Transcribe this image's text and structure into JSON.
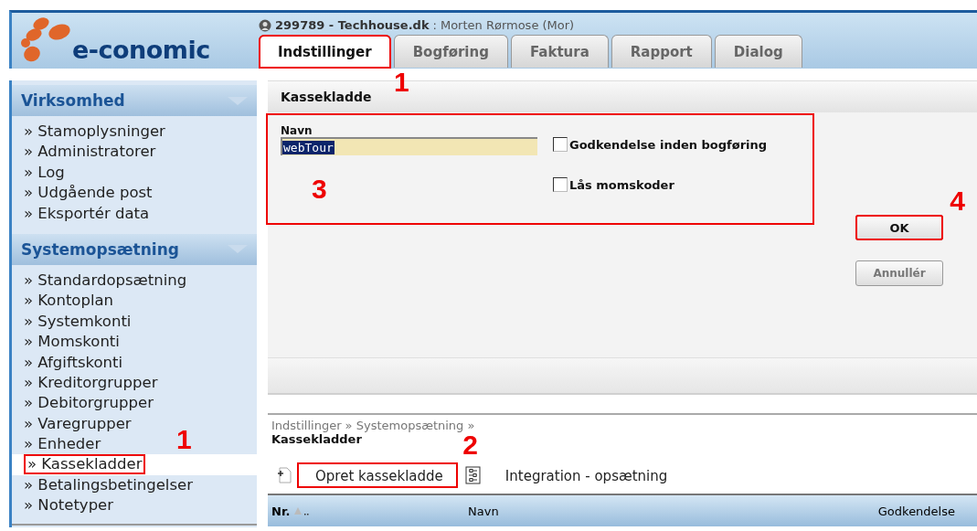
{
  "header": {
    "logo_text": "e-conomic",
    "account": "299789 - Techhouse.dk",
    "separator": ":",
    "user": "Morten Rørmose (Mor)"
  },
  "tabs": [
    {
      "label": "Indstillinger",
      "selected": true,
      "callout": "1"
    },
    {
      "label": "Bogføring",
      "selected": false
    },
    {
      "label": "Faktura",
      "selected": false
    },
    {
      "label": "Rapport",
      "selected": false
    },
    {
      "label": "Dialog",
      "selected": false
    }
  ],
  "sidebar": {
    "sections": [
      {
        "title": "Virksomhed",
        "items": [
          {
            "label": "» Stamoplysninger",
            "selected": false
          },
          {
            "label": "» Administratorer",
            "selected": false
          },
          {
            "label": "» Log",
            "selected": false
          },
          {
            "label": "» Udgående post",
            "selected": false
          },
          {
            "label": "» Eksportér data",
            "selected": false
          }
        ]
      },
      {
        "title": "Systemopsætning",
        "items": [
          {
            "label": "» Standardopsætning",
            "selected": false
          },
          {
            "label": "» Kontoplan",
            "selected": false
          },
          {
            "label": "» Systemkonti",
            "selected": false
          },
          {
            "label": "» Momskonti",
            "selected": false
          },
          {
            "label": "» Afgiftskonti",
            "selected": false
          },
          {
            "label": "» Kreditorgrupper",
            "selected": false
          },
          {
            "label": "» Debitorgrupper",
            "selected": false
          },
          {
            "label": "» Varegrupper",
            "selected": false
          },
          {
            "label": "» Enheder",
            "selected": false
          },
          {
            "label": "» Kassekladder",
            "selected": true,
            "callout": "1"
          },
          {
            "label": "» Betalingsbetingelser",
            "selected": false
          },
          {
            "label": "» Notetyper",
            "selected": false
          }
        ]
      }
    ]
  },
  "form": {
    "title": "Kassekladde",
    "callout": "3",
    "name_label": "Navn",
    "name_value": "webTour",
    "checkboxes": [
      {
        "label": "Godkendelse inden bogføring",
        "checked": false
      },
      {
        "label": "Lås momskoder",
        "checked": false
      }
    ],
    "buttons": [
      {
        "label": "OK",
        "kind": "primary",
        "callout": "4"
      },
      {
        "label": "Annullér",
        "kind": "secondary"
      }
    ]
  },
  "breadcrumb": "Indstillinger » Systemopsætning »",
  "page_title": "Kassekladder",
  "actions": [
    {
      "label": "Opret kassekladde",
      "kind": "add",
      "callout": "2"
    },
    {
      "label": "Integration - opsætning",
      "kind": "settings"
    }
  ],
  "table": {
    "columns": [
      {
        "label": "Nr.",
        "sorted": true
      },
      {
        "label": "Navn",
        "sorted": false
      },
      {
        "label": "Godkendelse",
        "sorted": false
      }
    ]
  }
}
